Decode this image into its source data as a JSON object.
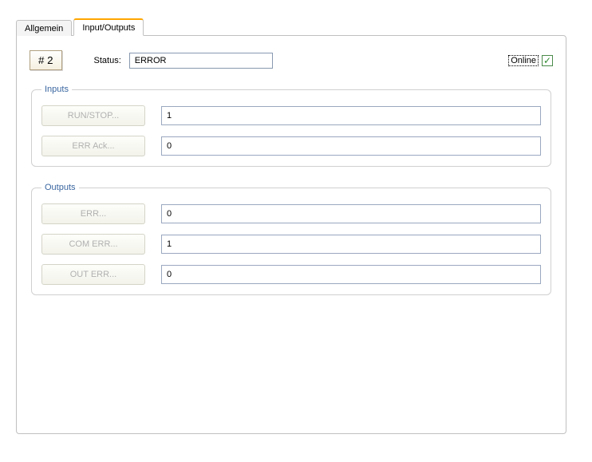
{
  "tabs": {
    "allgemein": "Allgemein",
    "io": "Input/Outputs"
  },
  "top": {
    "num_button": "# 2",
    "status_label": "Status:",
    "status_value": "ERROR",
    "online_label": "Online",
    "online_checked": "✓"
  },
  "inputs": {
    "legend": "Inputs",
    "rows": [
      {
        "btn": "RUN/STOP...",
        "val": "1"
      },
      {
        "btn": "ERR Ack...",
        "val": "0"
      }
    ]
  },
  "outputs": {
    "legend": "Outputs",
    "rows": [
      {
        "btn": "ERR...",
        "val": "0"
      },
      {
        "btn": "COM ERR...",
        "val": "1"
      },
      {
        "btn": "OUT ERR...",
        "val": "0"
      }
    ]
  }
}
